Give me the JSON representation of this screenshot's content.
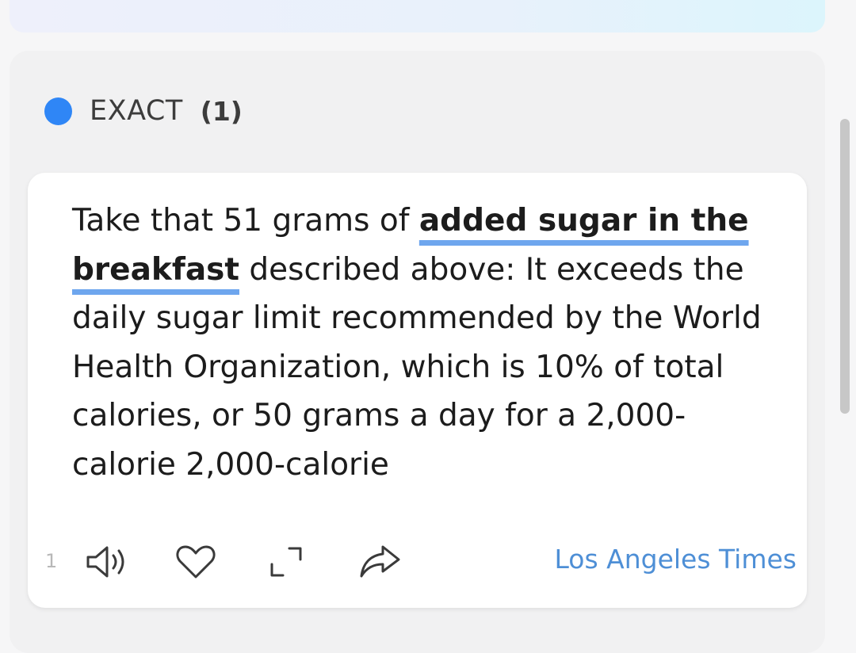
{
  "section": {
    "title": "EXACT",
    "count": "(1)",
    "dot_color": "#2f86f6"
  },
  "result": {
    "text_before": "Take that 51 grams of ",
    "highlight": "added sugar in the breakfast",
    "text_after": " described above: It exceeds the daily sugar limit recommended by the World Health Organization, which is 10% of total calories, or 50 grams a day for a 2,000-calorie 2,000-calorie",
    "index": "1",
    "source": "Los Angeles Times",
    "actions": [
      "speaker-icon",
      "heart-icon",
      "expand-icon",
      "share-icon"
    ]
  },
  "colors": {
    "accent": "#2f86f6",
    "highlight_underline": "#6ea6ee",
    "source_link": "#4e8fd6"
  }
}
